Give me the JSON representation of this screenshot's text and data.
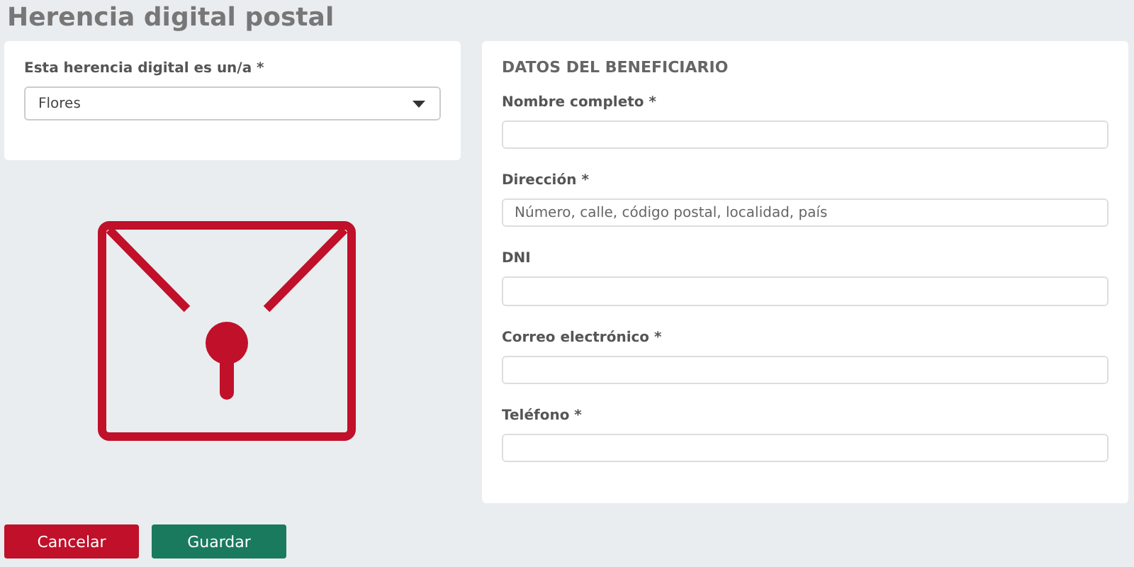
{
  "page_title": "Herencia digital postal",
  "type_select": {
    "label": "Esta herencia digital es un/a *",
    "value": "Flores"
  },
  "beneficiary": {
    "heading": "DATOS DEL BENEFICIARIO",
    "fields": [
      {
        "label": "Nombre completo *"
      },
      {
        "label": "Dirección *",
        "placeholder": "Número, calle, código postal, localidad, país"
      },
      {
        "label": "DNI"
      },
      {
        "label": "Correo electrónico *"
      },
      {
        "label": "Teléfono *"
      }
    ]
  },
  "buttons": [
    {
      "label": "Cancelar",
      "kind": "cancel"
    },
    {
      "label": "Guardar",
      "kind": "save"
    }
  ]
}
